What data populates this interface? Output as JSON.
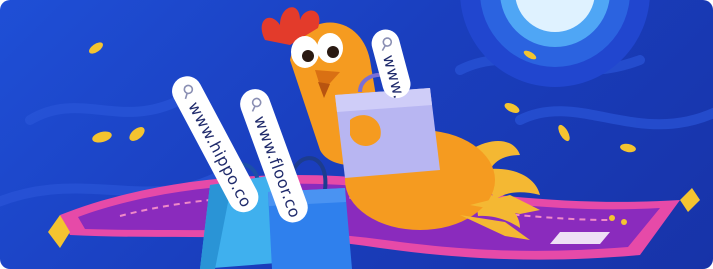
{
  "banner": {
    "search_tags": [
      {
        "text": "www.hippo.co"
      },
      {
        "text": "www.floor.co"
      },
      {
        "text": "www."
      }
    ]
  },
  "colors": {
    "background": "#1a3fbf",
    "moon_glow": "#4fa6f5",
    "carpet": "#8a2bbd",
    "carpet_border": "#e64aa8",
    "rooster": "#f59b20",
    "bag_lilac": "#b8b6f2",
    "bag_blue": "#2f80ed",
    "coin": "#f4c430"
  },
  "icons": [
    "search-icon",
    "coin-icon",
    "shopping-bag-icon",
    "rooster-illustration",
    "flying-carpet-illustration",
    "moon-icon"
  ]
}
